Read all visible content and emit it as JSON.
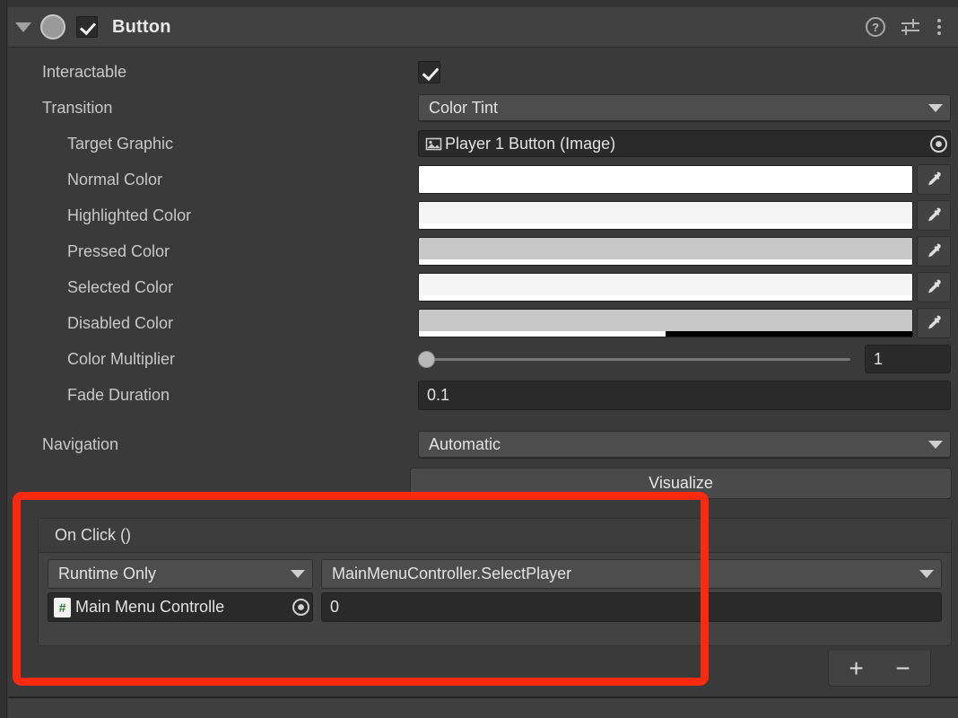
{
  "component": {
    "title": "Button",
    "enabled_checkbox": true,
    "foldout_expanded": true,
    "header_icons": [
      {
        "name": "help-icon",
        "glyph": "?"
      },
      {
        "name": "preset-icon",
        "glyph": "sliders"
      },
      {
        "name": "more-menu-icon",
        "glyph": "kebab"
      }
    ]
  },
  "properties": {
    "interactable": {
      "label": "Interactable",
      "value": true
    },
    "transition": {
      "label": "Transition",
      "value": "Color Tint"
    },
    "target_graphic": {
      "label": "Target Graphic",
      "value": "Player 1 Button (Image)",
      "icon": "image-icon"
    },
    "normal_color": {
      "label": "Normal Color",
      "color": "#ffffff",
      "alpha_pct": 100
    },
    "highlighted_color": {
      "label": "Highlighted Color",
      "color": "#f5f5f5",
      "alpha_pct": 100
    },
    "pressed_color": {
      "label": "Pressed Color",
      "color": "#c8c8c8",
      "alpha_pct": 100
    },
    "selected_color": {
      "label": "Selected Color",
      "color": "#f5f5f5",
      "alpha_pct": 100
    },
    "disabled_color": {
      "label": "Disabled Color",
      "color": "#c8c8c8",
      "alpha_pct": 50
    },
    "color_multiplier": {
      "label": "Color Multiplier",
      "value": "1",
      "slider_pct": 0
    },
    "fade_duration": {
      "label": "Fade Duration",
      "value": "0.1"
    },
    "navigation": {
      "label": "Navigation",
      "value": "Automatic"
    },
    "visualize": {
      "label": "Visualize"
    }
  },
  "on_click": {
    "title": "On Click ()",
    "entries": [
      {
        "mode": "Runtime Only",
        "method": "MainMenuController.SelectPlayer",
        "object": "Main Menu Controlle",
        "object_icon": "cs-script-icon",
        "argument": "0"
      }
    ],
    "add_label": "+",
    "remove_label": "−"
  },
  "colors": {
    "panel_bg": "#3a3a3a",
    "header_bg": "#414141",
    "field_bg": "#2a2a2a",
    "dropdown_bg": "#4d4d4d",
    "text": "#c8c8c8",
    "annotation_red": "#fc2a0c",
    "script_icon_green": "#2f7d32"
  }
}
